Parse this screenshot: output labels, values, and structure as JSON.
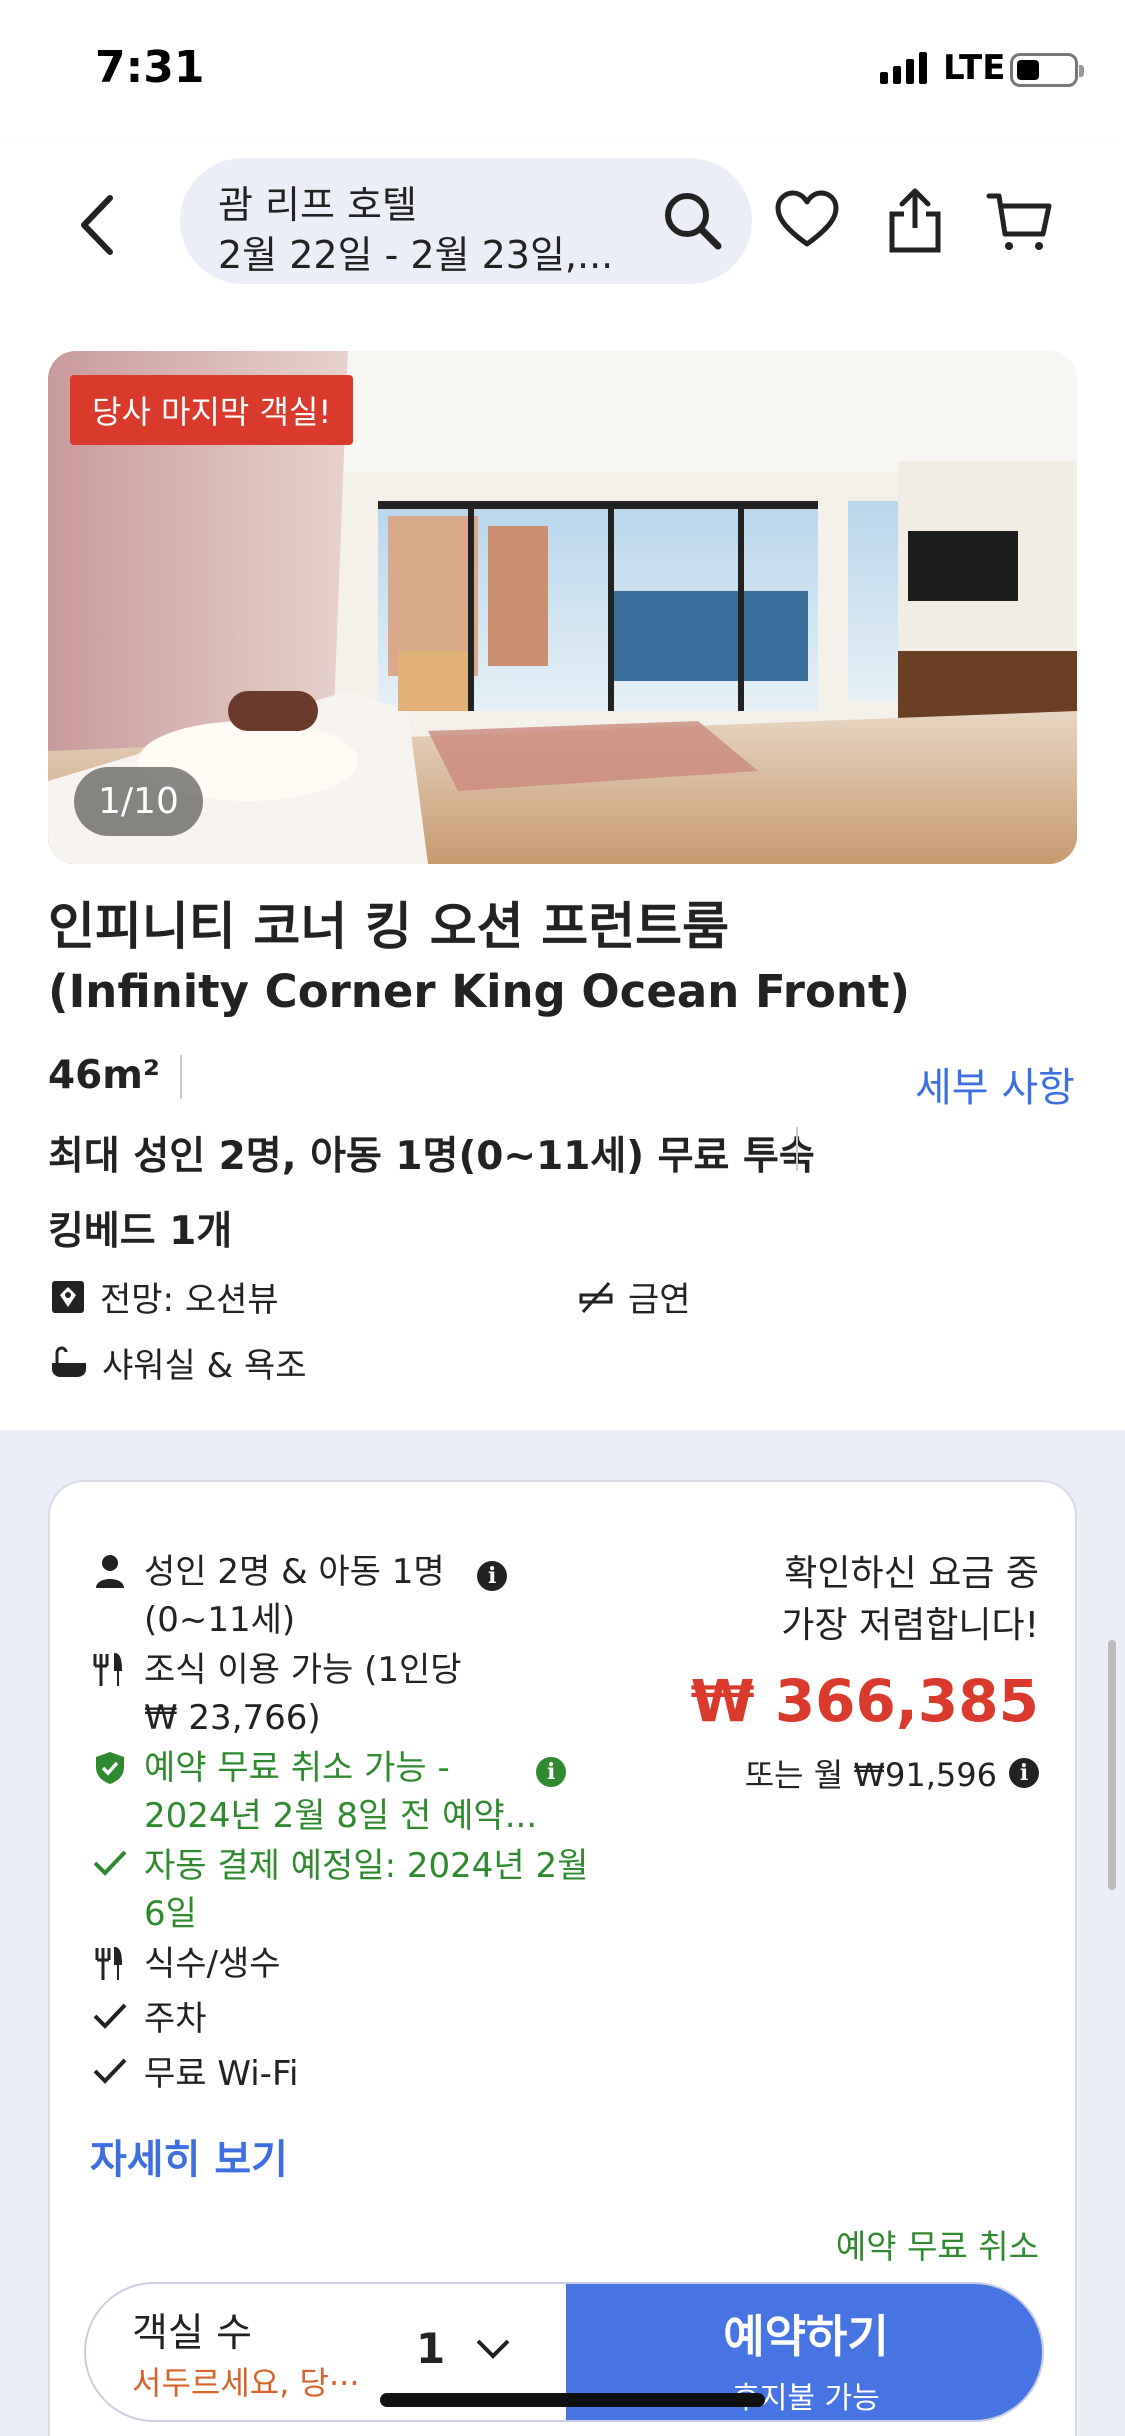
{
  "status": {
    "time": "7:31",
    "network": "LTE"
  },
  "header": {
    "title": "괌 리프 호텔",
    "dates": "2월 22일 - 2월 23일,..."
  },
  "photo": {
    "badge": "당사 마지막 객실!",
    "counter": "1/10"
  },
  "room": {
    "name": "인피니티 코너 킹 오션 프런트룸",
    "name_en": "(Infinity Corner King Ocean Front)",
    "size": "46m²",
    "details_link": "세부 사항",
    "occupancy": "최대 성인 2명, 아동 1명(0~11세) 무료 투숙",
    "bed": "킹베드 1개",
    "amenities": [
      {
        "icon": "view-icon",
        "label": "전망: 오션뷰"
      },
      {
        "icon": "no-smoking-icon",
        "label": "금연"
      },
      {
        "icon": "bathtub-icon",
        "label": "샤워실 & 욕조"
      }
    ]
  },
  "rate": {
    "guests": "성인 2명 & 아동 1명",
    "guests_sub": "(0~11세)",
    "breakfast": "조식 이용 가능 (1인당",
    "breakfast_sub": "₩ 23,766)",
    "cancel": "예약 무료 취소 가능 -",
    "cancel_sub": "2024년 2월 8일 전 예약...",
    "autopay": "자동 결제 예정일: 2024년 2월",
    "autopay_sub": "6일",
    "water": "식수/생수",
    "parking": "주차",
    "wifi": "무료 Wi-Fi",
    "more_link": "자세히 보기",
    "lowest_line1": "확인하신 요금 중",
    "lowest_line2": "가장 저렴합니다!",
    "price": "₩ 366,385",
    "monthly": "또는 월 ₩91,596",
    "free_cancel": "예약 무료 취소",
    "rooms_label": "객실 수",
    "rooms_sub": "서두르세요, 당···",
    "quantity": "1",
    "book_label": "예약하기",
    "book_sub": "후지불 가능"
  },
  "colors": {
    "accent": "#4674e3",
    "price": "#d93a2b",
    "green": "#2f8a2f",
    "link": "#3d6fe0"
  }
}
